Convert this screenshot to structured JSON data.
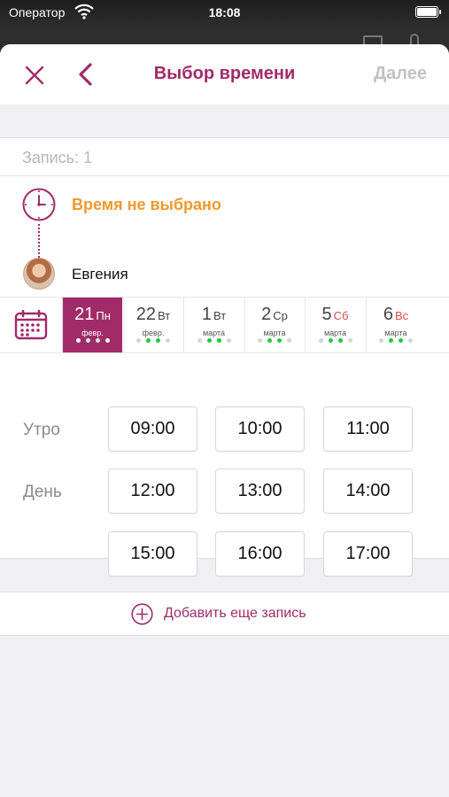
{
  "status_bar": {
    "carrier": "Оператор",
    "time": "18:08"
  },
  "nav": {
    "title": "Выбор времени",
    "next_label": "Далее"
  },
  "record": {
    "label": "Запись: 1"
  },
  "booking": {
    "time_status": "Время не выбрано",
    "master_name": "Евгения"
  },
  "dates": [
    {
      "day": "21",
      "dow": "Пн",
      "month": "февр.",
      "selected": true,
      "weekend": false,
      "dots": [
        "w",
        "g",
        "g",
        "w"
      ]
    },
    {
      "day": "22",
      "dow": "Вт",
      "month": "февр.",
      "selected": false,
      "weekend": false,
      "dots": [
        "n",
        "g",
        "g",
        "n"
      ]
    },
    {
      "day": "1",
      "dow": "Вт",
      "month": "марта",
      "selected": false,
      "weekend": false,
      "dots": [
        "n",
        "g",
        "g",
        "n"
      ]
    },
    {
      "day": "2",
      "dow": "Ср",
      "month": "марта",
      "selected": false,
      "weekend": false,
      "dots": [
        "n",
        "g",
        "g",
        "n"
      ]
    },
    {
      "day": "5",
      "dow": "Сб",
      "month": "марта",
      "selected": false,
      "weekend": true,
      "dots": [
        "n",
        "g",
        "g",
        "n"
      ]
    },
    {
      "day": "6",
      "dow": "Вс",
      "month": "марта",
      "selected": false,
      "weekend": true,
      "dots": [
        "n",
        "g",
        "g",
        "n"
      ]
    }
  ],
  "slots": {
    "morning_label": "Утро",
    "day_label": "День",
    "morning": [
      "09:00",
      "10:00",
      "11:00"
    ],
    "day_row1": [
      "12:00",
      "13:00",
      "14:00"
    ],
    "day_row2": [
      "15:00",
      "16:00",
      "17:00"
    ]
  },
  "add_record": {
    "label": "Добавить еще запись"
  },
  "colors": {
    "accent": "#a12b69",
    "warning": "#ef9a2b",
    "available": "#1ecb3c",
    "weekend": "#e34b4b"
  }
}
